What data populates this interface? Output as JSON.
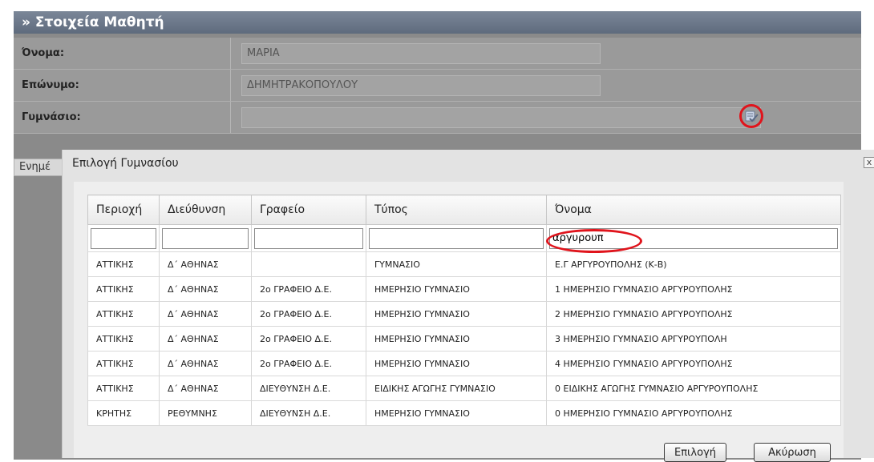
{
  "panel": {
    "title": "» Στοιχεία Μαθητή",
    "fields": {
      "name": {
        "label": "Όνομα:",
        "value": "ΜΑΡΙΑ"
      },
      "surname": {
        "label": "Επώνυμο:",
        "value": "ΔΗΜΗΤΡΑΚΟΠΟΥΛΟΥ"
      },
      "gymnasium": {
        "label": "Γυμνάσιο:",
        "value": ""
      }
    },
    "picker_icon": "search-list-icon",
    "side_tab": "Ενημέ"
  },
  "dialog": {
    "title": "Επιλογή Γυμνασίου",
    "close": "x",
    "columns": [
      "Περιοχή",
      "Διεύθυνση",
      "Γραφείο",
      "Τύπος",
      "Όνομα"
    ],
    "filters": [
      "",
      "",
      "",
      "",
      "αργυρουπ"
    ],
    "rows": [
      [
        "ΑΤΤΙΚΗΣ",
        "Δ΄ ΑΘΗΝΑΣ",
        "",
        "ΓΥΜΝΑΣΙΟ",
        "Ε.Γ ΑΡΓΥΡΟΥΠΟΛΗΣ (Κ-Β)"
      ],
      [
        "ΑΤΤΙΚΗΣ",
        "Δ΄ ΑΘΗΝΑΣ",
        "2ο ΓΡΑΦΕΙΟ Δ.Ε.",
        "ΗΜΕΡΗΣΙΟ ΓΥΜΝΑΣΙΟ",
        "1 ΗΜΕΡΗΣΙΟ ΓΥΜΝΑΣΙΟ ΑΡΓΥΡΟΥΠΟΛΗΣ"
      ],
      [
        "ΑΤΤΙΚΗΣ",
        "Δ΄ ΑΘΗΝΑΣ",
        "2ο ΓΡΑΦΕΙΟ Δ.Ε.",
        "ΗΜΕΡΗΣΙΟ ΓΥΜΝΑΣΙΟ",
        "2 ΗΜΕΡΗΣΙΟ ΓΥΜΝΑΣΙΟ ΑΡΓΥΡΟΥΠΟΛΗΣ"
      ],
      [
        "ΑΤΤΙΚΗΣ",
        "Δ΄ ΑΘΗΝΑΣ",
        "2ο ΓΡΑΦΕΙΟ Δ.Ε.",
        "ΗΜΕΡΗΣΙΟ ΓΥΜΝΑΣΙΟ",
        "3 ΗΜΕΡΗΣΙΟ ΓΥΜΝΑΣΙΟ ΑΡΓΥΡΟΥΠΟΛΗ"
      ],
      [
        "ΑΤΤΙΚΗΣ",
        "Δ΄ ΑΘΗΝΑΣ",
        "2ο ΓΡΑΦΕΙΟ Δ.Ε.",
        "ΗΜΕΡΗΣΙΟ ΓΥΜΝΑΣΙΟ",
        "4 ΗΜΕΡΗΣΙΟ ΓΥΜΝΑΣΙΟ ΑΡΓΥΡΟΥΠΟΛΗΣ"
      ],
      [
        "ΑΤΤΙΚΗΣ",
        "Δ΄ ΑΘΗΝΑΣ",
        "ΔΙΕΥΘΥΝΣΗ Δ.Ε.",
        "ΕΙΔΙΚΗΣ ΑΓΩΓΗΣ ΓΥΜΝΑΣΙΟ",
        "0 ΕΙΔΙΚΗΣ ΑΓΩΓΗΣ ΓΥΜΝΑΣΙΟ ΑΡΓΥΡΟΥΠΟΛΗΣ"
      ],
      [
        "ΚΡΗΤΗΣ",
        "ΡΕΘΥΜΝΗΣ",
        "ΔΙΕΥΘΥΝΣΗ Δ.Ε.",
        "ΗΜΕΡΗΣΙΟ ΓΥΜΝΑΣΙΟ",
        "0 ΗΜΕΡΗΣΙΟ ΓΥΜΝΑΣΙΟ ΑΡΓΥΡΟΥΠΟΛΗΣ"
      ]
    ],
    "buttons": {
      "select": "Επιλογή",
      "cancel": "Ακύρωση"
    }
  },
  "colors": {
    "highlight_ring": "#e0141c",
    "header_bar": "#6c798b",
    "overlay": "#8a8a8a"
  }
}
